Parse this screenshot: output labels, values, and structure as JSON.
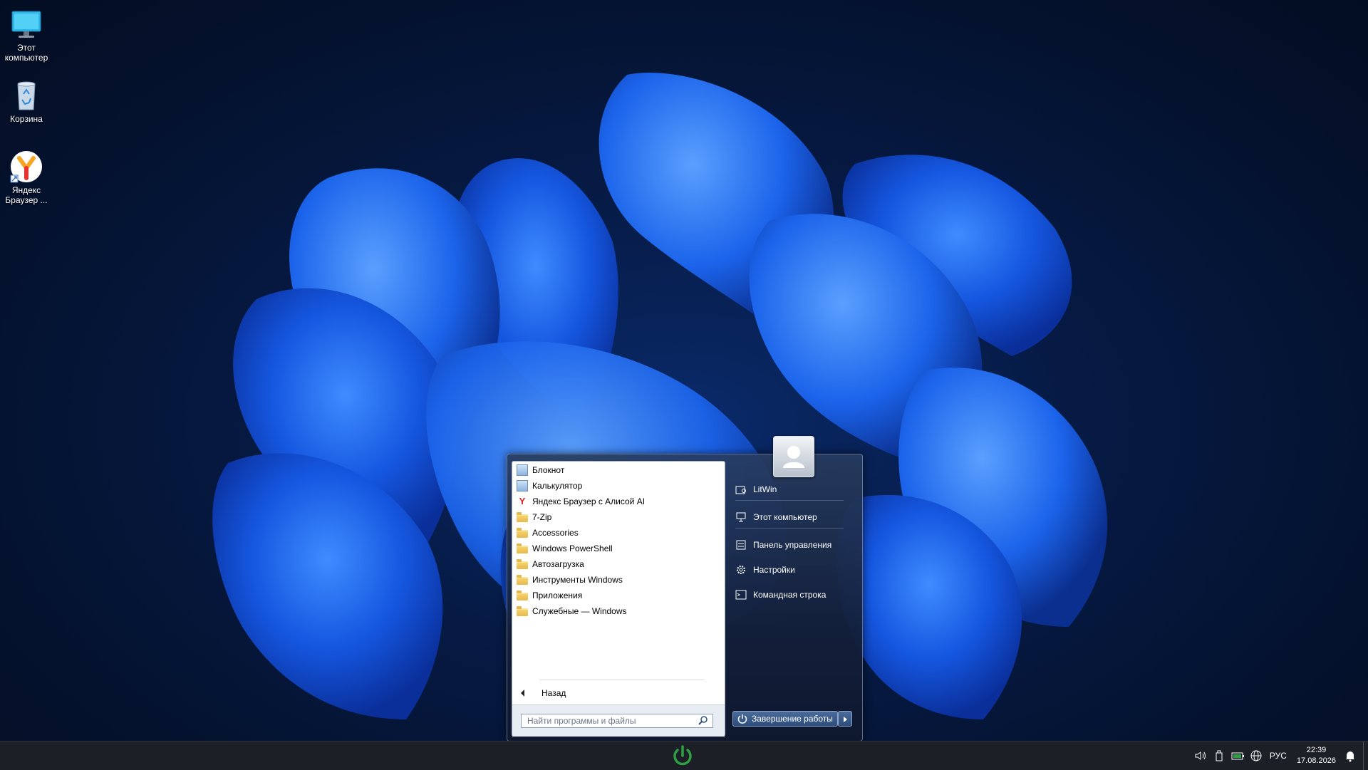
{
  "desktop": {
    "icons": [
      {
        "label": "Этот компьютер",
        "icon": "monitor-icon"
      },
      {
        "label": "Корзина",
        "icon": "recycle-bin-icon"
      },
      {
        "label": "Яндекс Браузер ...",
        "icon": "yandex-browser-icon"
      }
    ]
  },
  "start_menu": {
    "programs": [
      {
        "label": "Блокнот",
        "icon": "notepad-icon"
      },
      {
        "label": "Калькулятор",
        "icon": "calculator-icon"
      },
      {
        "label": "Яндекс Браузер с Алисой AI",
        "icon": "yandex-icon"
      },
      {
        "label": "7-Zip",
        "icon": "folder-icon"
      },
      {
        "label": "Accessories",
        "icon": "folder-icon"
      },
      {
        "label": "Windows PowerShell",
        "icon": "folder-icon"
      },
      {
        "label": "Автозагрузка",
        "icon": "folder-icon"
      },
      {
        "label": "Инструменты Windows",
        "icon": "folder-icon"
      },
      {
        "label": "Приложения",
        "icon": "apps-folder-icon"
      },
      {
        "label": "Служебные — Windows",
        "icon": "folder-icon"
      }
    ],
    "back_label": "Назад",
    "search_placeholder": "Найти программы и файлы",
    "right": {
      "user": "LitWin",
      "items": [
        "Этот компьютер",
        "Панель управления",
        "Настройки",
        "Командная строка"
      ]
    },
    "shutdown_label": "Завершение работы"
  },
  "taskbar": {
    "language": "РУС",
    "time": "22:39",
    "date": "17.08.2026",
    "accent": "#2ea043"
  }
}
